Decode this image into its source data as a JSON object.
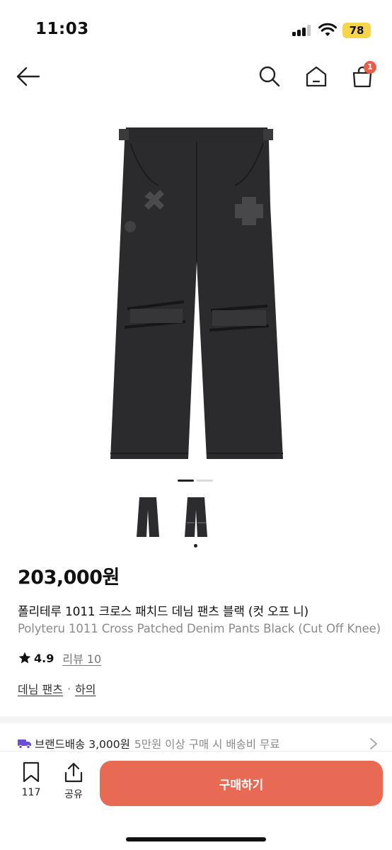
{
  "status_bar": {
    "time": "11:03",
    "battery": "78"
  },
  "nav": {
    "cart_count": "1"
  },
  "product": {
    "price": "203,000원",
    "title_ko": "폴리테루 1011 크로스 패치드 데님 팬츠 블랙 (컷 오프 니)",
    "title_en": "Polyteru 1011 Cross Patched Denim Pants Black (Cut Off Knee)",
    "rating": "4.9",
    "review_label": "리뷰 10",
    "categories": [
      "데님 팬츠",
      "하의"
    ],
    "category_separator": "·",
    "carousel": {
      "total": 2,
      "active_index": 0
    }
  },
  "shipping": {
    "label": "브랜드배송 3,000원",
    "note": "5만원 이상 구매 시 배송비 무료"
  },
  "bottom_bar": {
    "bookmark_count": "117",
    "share_label": "공유",
    "buy_label": "구매하기"
  },
  "colors": {
    "accent": "#e86a55",
    "badge": "#e5604b",
    "truck": "#6a4fd6",
    "battery": "#f5d64a"
  }
}
